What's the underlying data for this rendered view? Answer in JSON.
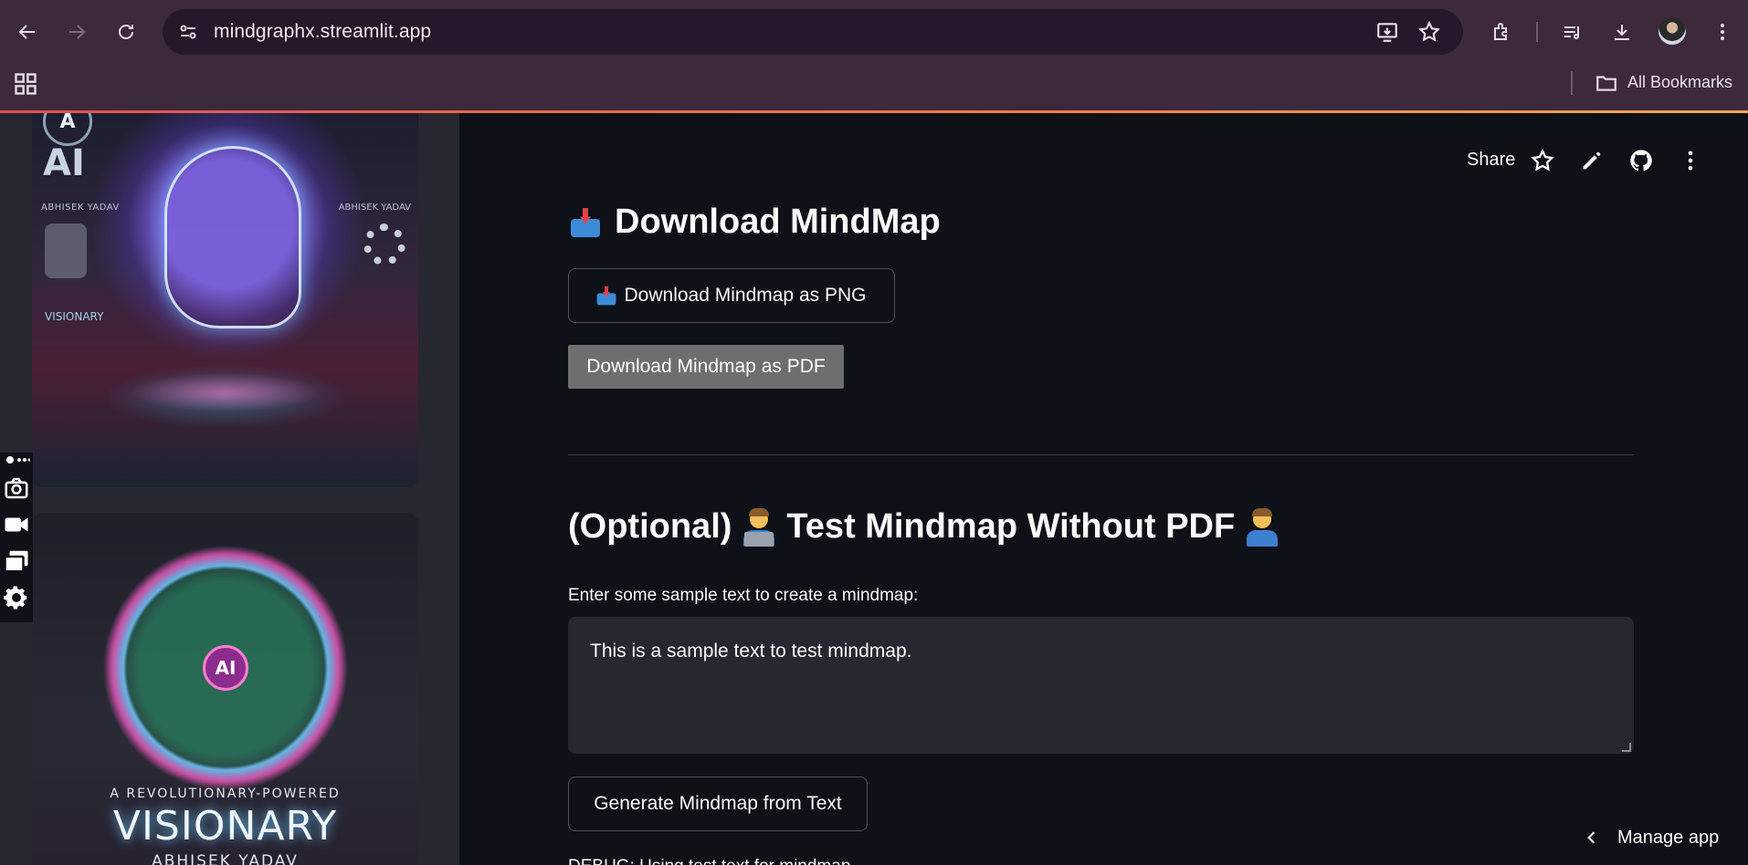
{
  "browser": {
    "url": "mindgraphx.streamlit.app",
    "bookmarks_label": "All Bookmarks"
  },
  "sidebar": {
    "cover1": {
      "badge": "A",
      "big_label": "AI",
      "author_left": "ABHISEK YADAV",
      "author_right": "ABHISEK YADAV",
      "caption": "VISIONARY"
    },
    "cover2": {
      "badge": "AI",
      "tagline": "A REVOLUTIONARY-POWERED",
      "title": "VISIONARY",
      "author": "ABHISEK YADAV"
    }
  },
  "toolbar": {
    "share_label": "Share"
  },
  "main": {
    "page_title": "Download MindMap",
    "download_png_label": "Download Mindmap as PNG",
    "download_pdf_label": "Download Mindmap as PDF",
    "section_title_prefix": "(Optional)",
    "section_title_main": "Test Mindmap Without PDF",
    "field_label": "Enter some sample text to create a mindmap:",
    "field_value": "This is a sample text to test mindmap.",
    "generate_label": "Generate Mindmap from Text",
    "debug_text": "DEBUG: Using test text for mindmap"
  },
  "manage_app": {
    "label": "Manage app"
  },
  "colors": {
    "browser_chrome": "#3c2a3c",
    "app_background": "#0e1117",
    "sidebar_background": "#262730",
    "accent_line": "#f07e4c"
  },
  "icons": [
    "back-icon",
    "forward-icon",
    "reload-icon",
    "site-info-icon",
    "install-icon",
    "star-icon",
    "extensions-icon",
    "media-icon",
    "downloads-icon",
    "menu-icon",
    "apps-icon",
    "folder-icon",
    "github-icon",
    "edit-icon",
    "chevron-left-icon"
  ]
}
